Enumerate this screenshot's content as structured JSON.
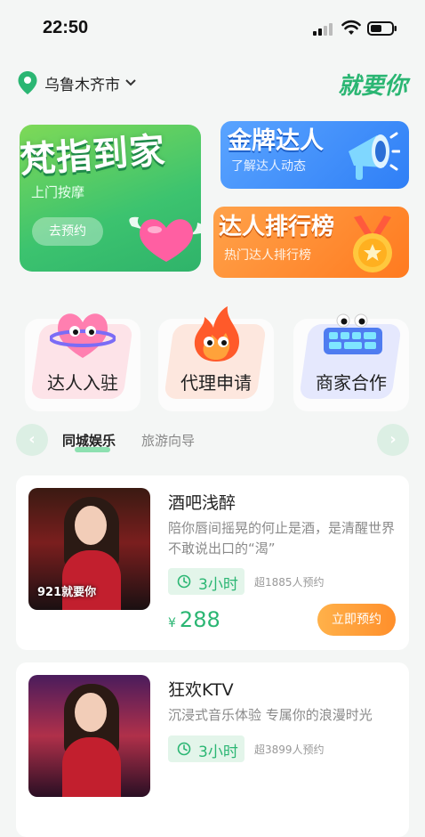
{
  "status_bar": {
    "time": "22:50"
  },
  "header": {
    "city": "乌鲁木齐市",
    "slogan": "就要你"
  },
  "banner_main": {
    "title": "梵指到家",
    "subtitle": "上门按摩",
    "button": "去预约"
  },
  "banner_gold": {
    "title": "金牌达人",
    "subtitle": "了解达人动态"
  },
  "banner_rank": {
    "title": "达人排行榜",
    "subtitle": "热门达人排行榜"
  },
  "features": [
    {
      "label": "达人入驻",
      "icon": "heart-planet-icon"
    },
    {
      "label": "代理申请",
      "icon": "flame-icon"
    },
    {
      "label": "商家合作",
      "icon": "keyboard-icon"
    }
  ],
  "tabs": [
    {
      "label": "同城娱乐",
      "active": true
    },
    {
      "label": "旅游向导",
      "active": false
    }
  ],
  "products": [
    {
      "title": "酒吧浅醉",
      "description": "陪你唇间摇晃的何止是酒，是清醒世界不敢说出口的“渴”",
      "duration": "3小时",
      "booked": "超1885人预约",
      "currency": "¥",
      "price": "288",
      "button": "立即预约",
      "thumb_text": "921就要你"
    },
    {
      "title": "狂欢KTV",
      "description": "沉浸式音乐体验 专属你的浪漫时光",
      "duration": "3小时",
      "booked": "超3899人预约"
    }
  ],
  "colors": {
    "accent": "#2bb673",
    "orange": "#ff8f2b",
    "blue": "#2f7ff6"
  }
}
